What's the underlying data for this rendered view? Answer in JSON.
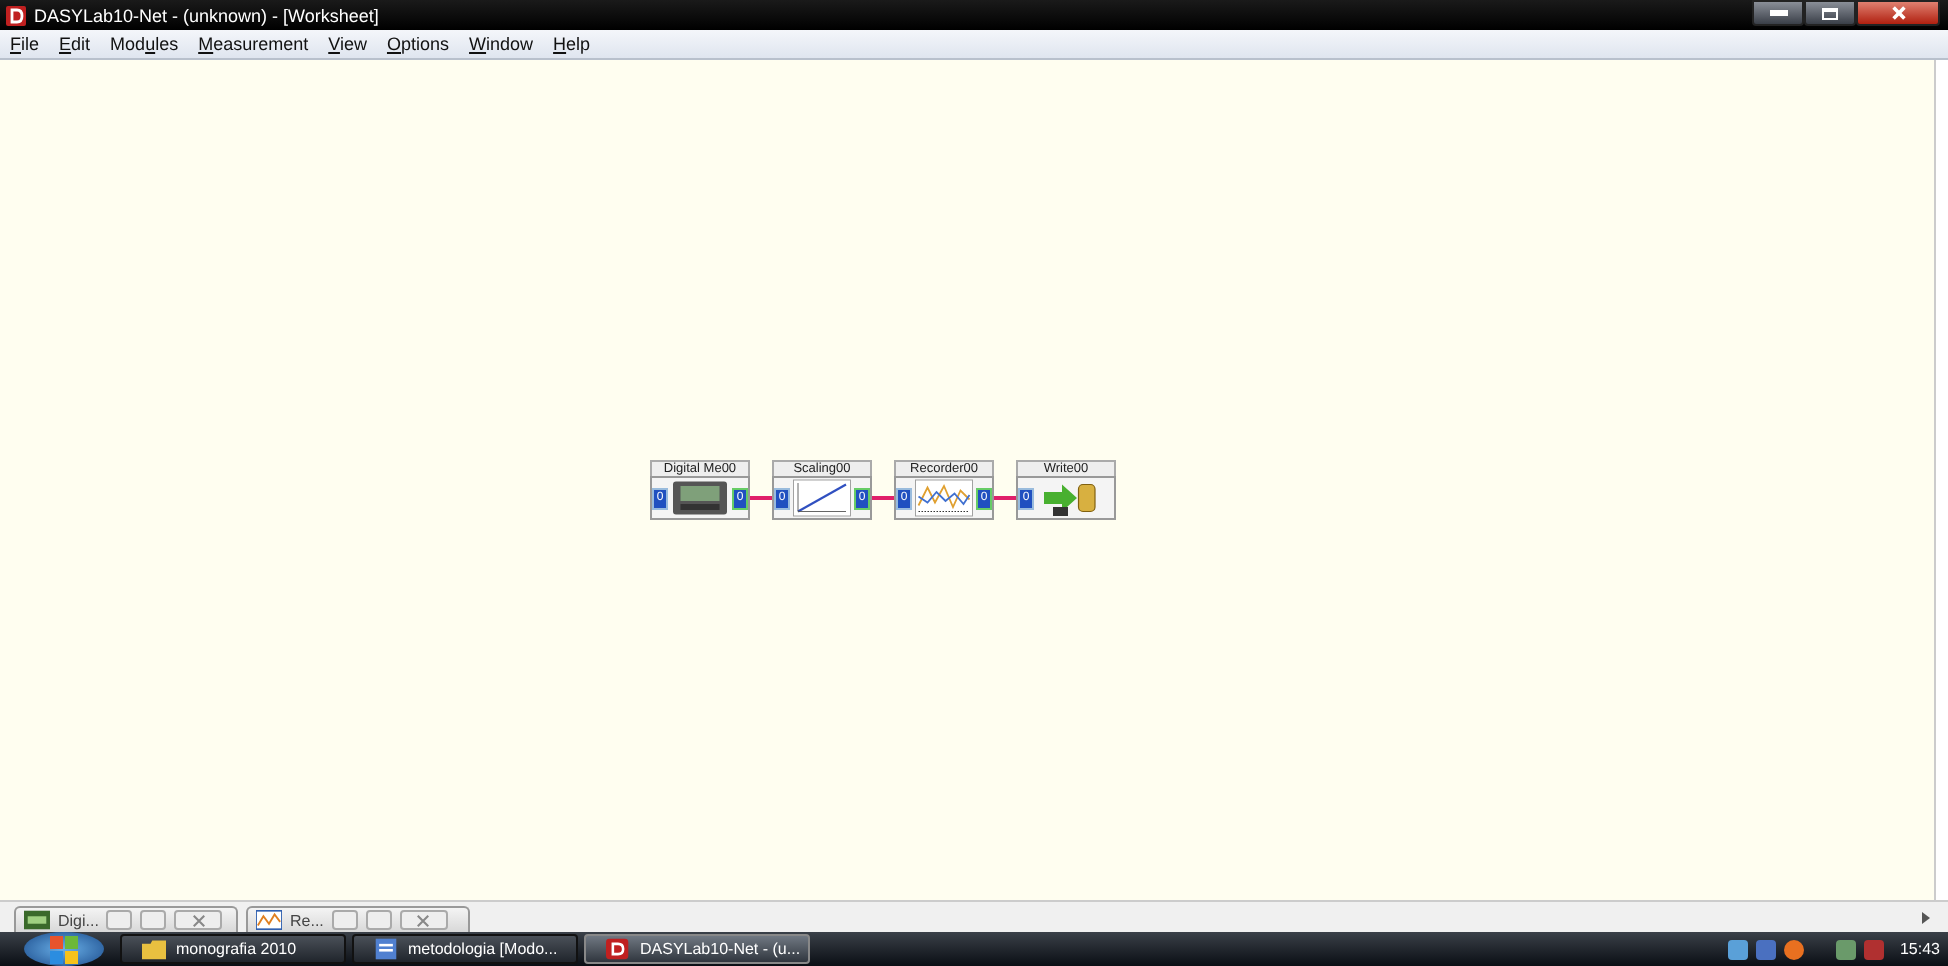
{
  "window": {
    "title": "DASYLab10-Net - (unknown) - [Worksheet]"
  },
  "menu": [
    {
      "key": "F",
      "post": "ile"
    },
    {
      "key": "E",
      "post": "dit"
    },
    {
      "pre": "Mod",
      "key": "u",
      "post": "les"
    },
    {
      "key": "M",
      "post": "easurement"
    },
    {
      "key": "V",
      "post": "iew"
    },
    {
      "key": "O",
      "post": "ptions"
    },
    {
      "key": "W",
      "post": "indow"
    },
    {
      "key": "H",
      "post": "elp"
    }
  ],
  "modules": [
    {
      "title": "Digital Me00",
      "kind": "meter",
      "input": "0",
      "output": "0"
    },
    {
      "title": "Scaling00",
      "kind": "scaling",
      "input": "0",
      "output": "0"
    },
    {
      "title": "Recorder00",
      "kind": "recorder",
      "input": "0",
      "output": "0"
    },
    {
      "title": "Write00",
      "kind": "write",
      "input": "0"
    }
  ],
  "minimized_windows": [
    {
      "title": "Digi...",
      "kind": "meter"
    },
    {
      "title": "Re...",
      "kind": "recorder"
    }
  ],
  "taskbar": {
    "buttons": [
      {
        "label": "monografia 2010",
        "kind": "folder",
        "selected": false
      },
      {
        "label": "metodologia [Modo...",
        "kind": "document",
        "selected": false
      },
      {
        "label": "DASYLab10-Net - (u...",
        "kind": "app",
        "selected": true
      }
    ],
    "clock": "15:43"
  }
}
